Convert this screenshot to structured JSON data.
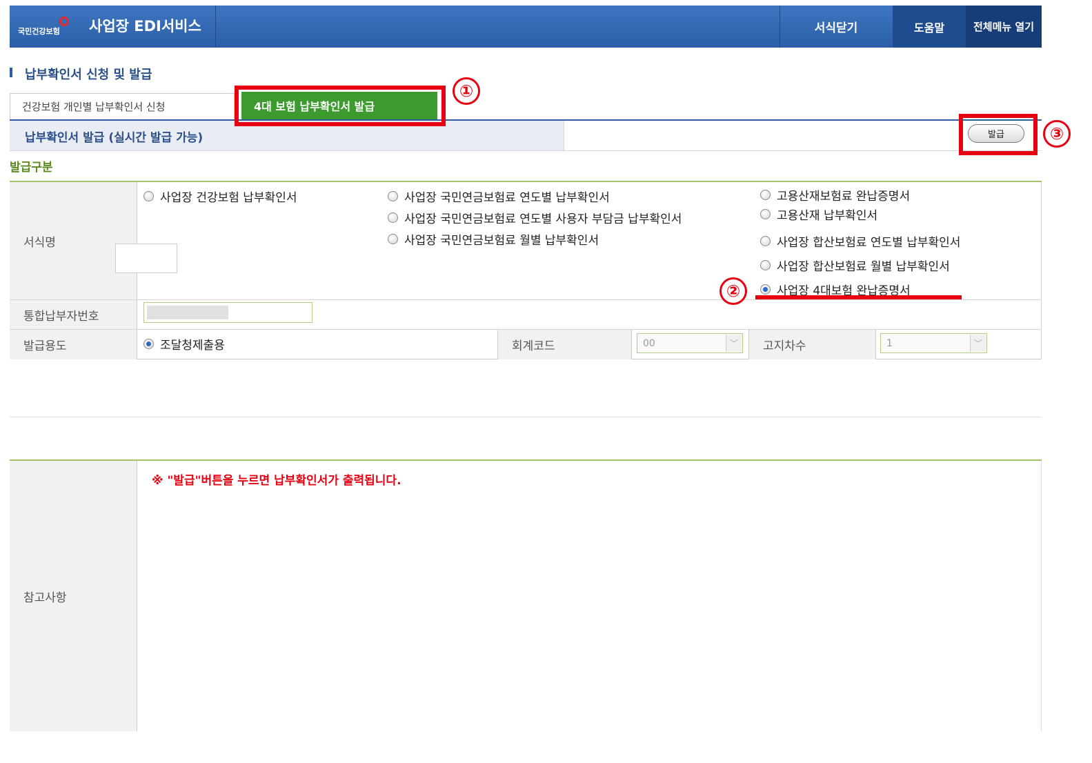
{
  "header": {
    "logo_text": "국민건강보험",
    "app_title": "사업장 EDI서비스",
    "close_form": "서식닫기",
    "help": "도움말",
    "all_menu": "전체메뉴 열기"
  },
  "page": {
    "section_title": "납부확인서 신청 및 발급"
  },
  "tabs": [
    {
      "label": "건강보험 개인별 납부확인서 신청",
      "active": false
    },
    {
      "label": "4대 보험 납부확인서 발급",
      "active": true
    }
  ],
  "subheader": {
    "title": "납부확인서 발급 (실시간 발급 가능)",
    "issue_button": "발급"
  },
  "annotations": {
    "step1": "①",
    "step2": "②",
    "step3": "③",
    "highlight_color": "#e60012"
  },
  "form": {
    "issue_type_label": "발급구분",
    "form_name_label": "서식명",
    "options": [
      {
        "label": "사업장 건강보험 납부확인서",
        "selected": false
      },
      {
        "label": "사업장 국민연금보험료 연도별 납부확인서",
        "selected": false
      },
      {
        "label": "사업장 국민연금보험료 연도별 사용자 부담금 납부확인서",
        "selected": false
      },
      {
        "label": "사업장 국민연금보험료 월별 납부확인서",
        "selected": false
      },
      {
        "label": "고용산재보험료 완납증명서",
        "selected": false
      },
      {
        "label": "고용산재 납부확인서",
        "selected": false
      },
      {
        "label": "사업장 합산보험료 연도별 납부확인서",
        "selected": false
      },
      {
        "label": "사업장 합산보험료 월별 납부확인서",
        "selected": false
      },
      {
        "label": "사업장 4대보험 완납증명서",
        "selected": true
      }
    ],
    "payer_number_label": "통합납부자번호",
    "purpose_label": "발급용도",
    "purpose_option": "조달청제출용",
    "account_code_label": "회계코드",
    "account_code_value": "00",
    "notice_count_label": "고지차수",
    "notice_count_value": "1"
  },
  "reference": {
    "label": "참고사항",
    "note": "※ \"발급\"버튼을 누르면 납부확인서가 출력됩니다."
  },
  "colors": {
    "header_blue": "#2a5ea8",
    "tab_active_green": "#3c9a2e",
    "section_green": "#5c8a1e"
  }
}
